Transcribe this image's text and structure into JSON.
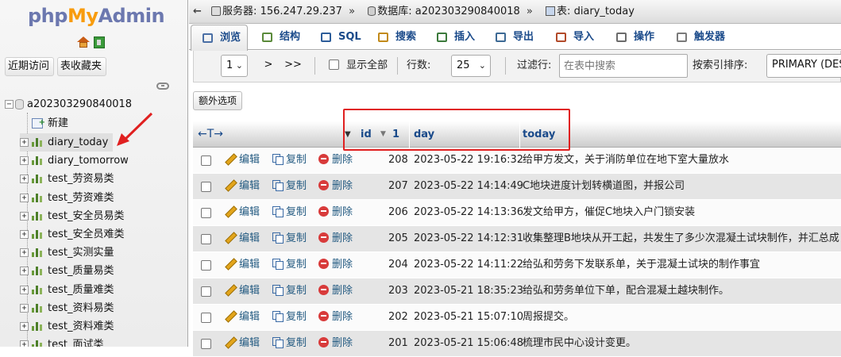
{
  "sidebar": {
    "logo": {
      "part1": "php",
      "part2": "My",
      "part3": "Admin"
    },
    "recent_label": "近期访问",
    "favorites_label": "表收藏夹",
    "database": "a202303290840018",
    "new_label": "新建",
    "tables": [
      "diary_today",
      "diary_tomorrow",
      "test_劳资易类",
      "test_劳资难类",
      "test_安全员易类",
      "test_安全员难类",
      "test_实测实量",
      "test_质量易类",
      "test_质量难类",
      "test_资料易类",
      "test_资料难类",
      "test_面试类"
    ],
    "selected_table": "diary_today"
  },
  "breadcrumb": {
    "server_label": "服务器:",
    "server_value": "156.247.29.237",
    "db_label": "数据库:",
    "db_value": "a202303290840018",
    "table_label": "表:",
    "table_value": "diary_today"
  },
  "tabs": [
    {
      "label": "浏览",
      "icon": "browse-icon"
    },
    {
      "label": "结构",
      "icon": "structure-icon"
    },
    {
      "label": "SQL",
      "icon": "sql-icon"
    },
    {
      "label": "搜索",
      "icon": "search-icon"
    },
    {
      "label": "插入",
      "icon": "insert-icon"
    },
    {
      "label": "导出",
      "icon": "export-icon"
    },
    {
      "label": "导入",
      "icon": "import-icon"
    },
    {
      "label": "操作",
      "icon": "wrench-icon"
    },
    {
      "label": "触发器",
      "icon": "trigger-icon"
    }
  ],
  "navigation": {
    "page_value": "1",
    "next_label": ">",
    "last_label": ">>",
    "show_all_label": "显示全部",
    "rows_label": "行数:",
    "rows_value": "25",
    "filter_label": "过滤行:",
    "filter_placeholder": "在表中搜索",
    "sort_label": "按索引排序:",
    "sort_value": "PRIMARY (DES"
  },
  "extra_options_label": "额外选项",
  "grid": {
    "nav_arrows": "←T→",
    "columns": [
      "id",
      "day",
      "today"
    ],
    "sort_marker": "1",
    "action_edit": "编辑",
    "action_copy": "复制",
    "action_delete": "删除",
    "rows": [
      {
        "id": "208",
        "day": "2023-05-22 19:16:32",
        "today": "给甲方发文，关于消防单位在地下室大量放水"
      },
      {
        "id": "207",
        "day": "2023-05-22 14:14:49",
        "today": "C地块进度计划转横道图，并报公司"
      },
      {
        "id": "206",
        "day": "2023-05-22 14:13:36",
        "today": "发文给甲方，催促C地块入户门锁安装"
      },
      {
        "id": "205",
        "day": "2023-05-22 14:12:31",
        "today": "收集整理B地块从开工起，共发生了多少次混凝土试块制作，并汇总成"
      },
      {
        "id": "204",
        "day": "2023-05-22 14:11:22",
        "today": "给弘和劳务下发联系单，关于混凝土试块的制作事宜"
      },
      {
        "id": "203",
        "day": "2023-05-21 18:35:23",
        "today": "给弘和劳务单位下单，配合混凝土越块制作。"
      },
      {
        "id": "202",
        "day": "2023-05-21 15:07:10",
        "today": "周报提交。"
      },
      {
        "id": "201",
        "day": "2023-05-21 15:06:48",
        "today": "梳理市民中心设计变更。"
      }
    ]
  },
  "colors": {
    "link": "#235a81",
    "annotation_red": "#e02020",
    "logo_blue": "#6c78af",
    "logo_orange": "#f89c0e"
  }
}
